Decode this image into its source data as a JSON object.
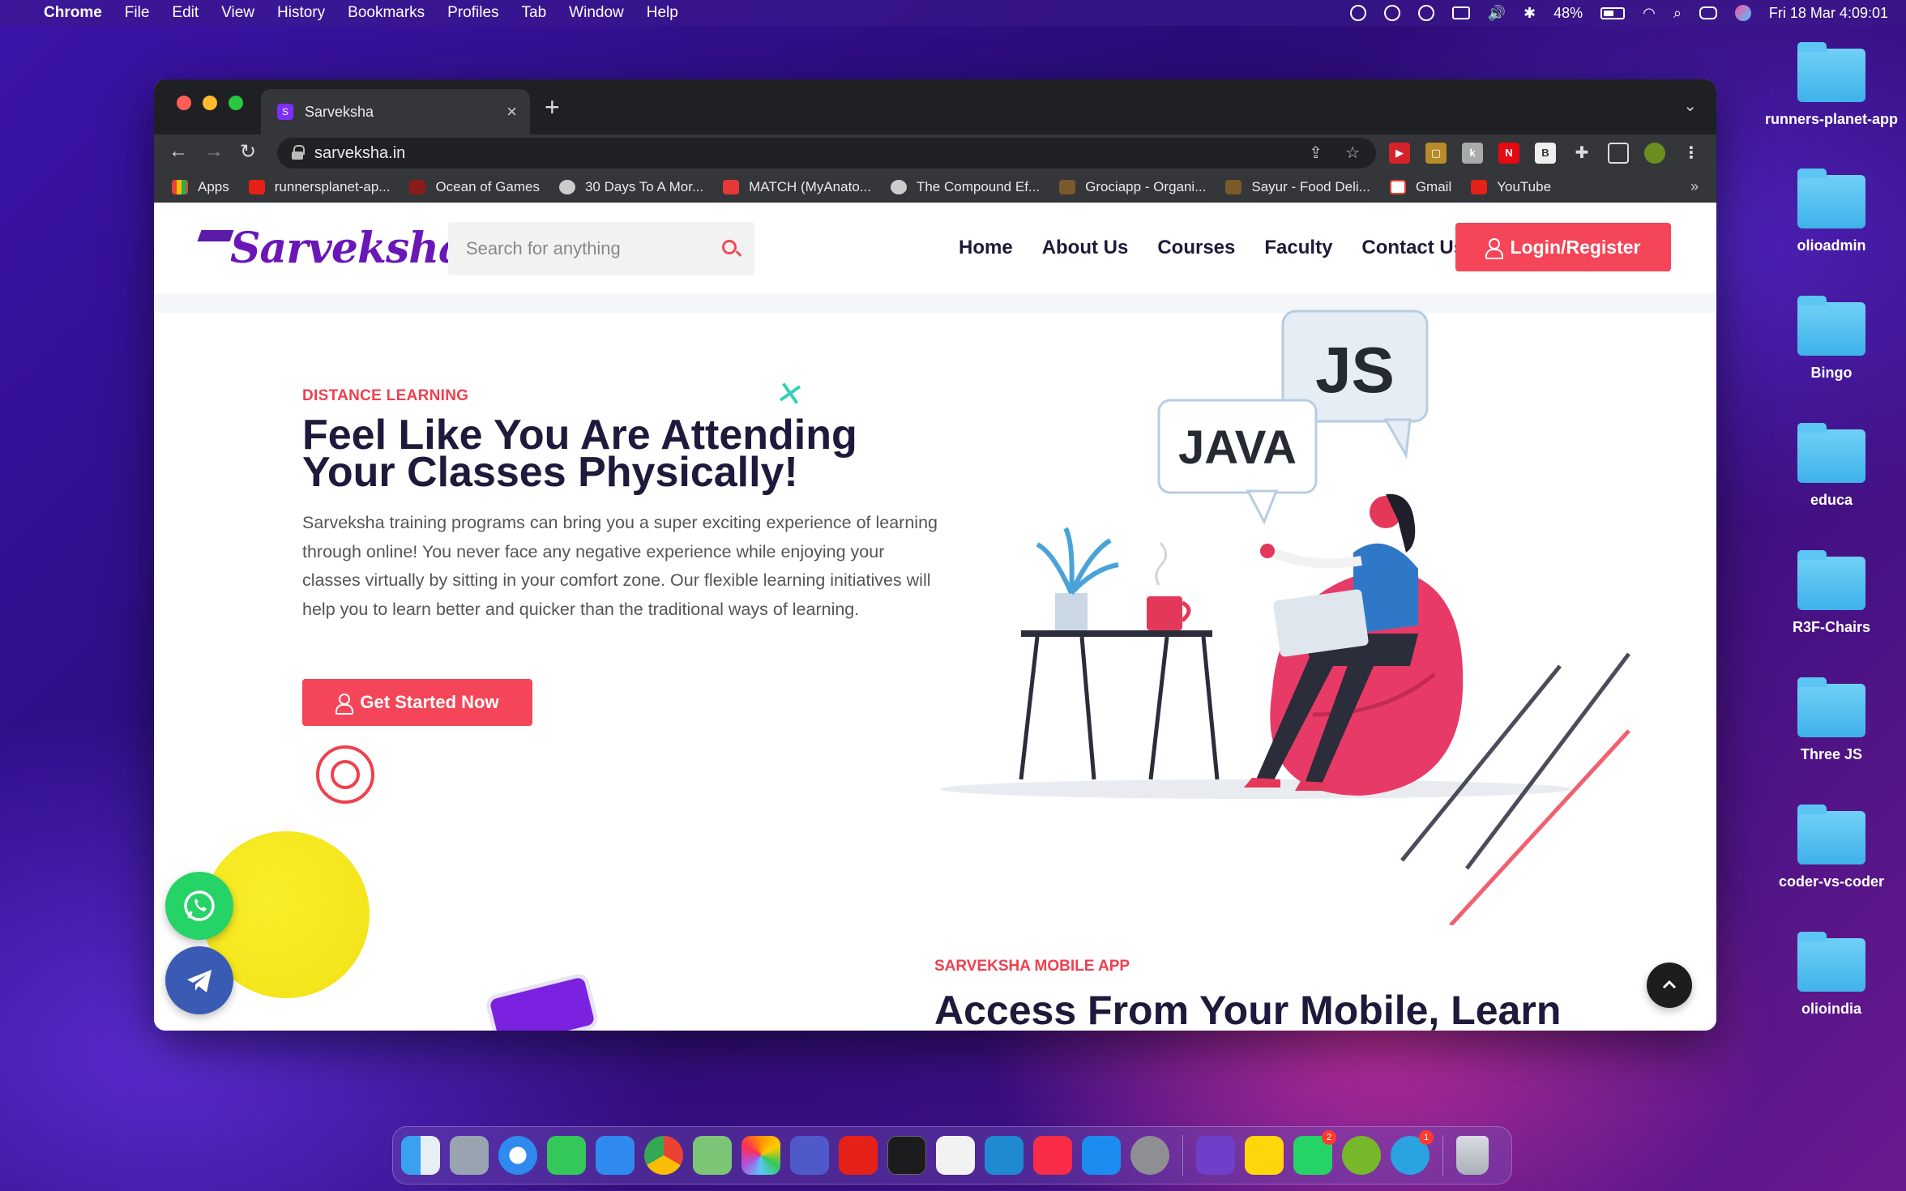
{
  "menubar": {
    "app_name": "Chrome",
    "menus": [
      "File",
      "Edit",
      "View",
      "History",
      "Bookmarks",
      "Profiles",
      "Tab",
      "Window",
      "Help"
    ],
    "battery": "48%",
    "datetime": "Fri 18 Mar  4:09:01"
  },
  "desktop_folders": [
    "runners-planet-app",
    "olioadmin",
    "Bingo",
    "educa",
    "R3F-Chairs",
    "Three JS",
    "coder-vs-coder",
    "olioindia"
  ],
  "browser": {
    "tab_title": "Sarveksha",
    "url": "sarveksha.in",
    "bookmarks": [
      "Apps",
      "runnersplanet-ap...",
      "Ocean of Games",
      "30 Days To A Mor...",
      "MATCH (MyAnato...",
      "The Compound Ef...",
      "Grociapp - Organi...",
      "Sayur - Food Deli...",
      "Gmail",
      "YouTube"
    ],
    "bookmarks_more": "»"
  },
  "site": {
    "logo": "Sarveksha",
    "search_placeholder": "Search for anything",
    "nav": [
      "Home",
      "About Us",
      "Courses",
      "Faculty",
      "Contact Us"
    ],
    "login_label": "Login/Register",
    "hero": {
      "eyebrow": "DISTANCE LEARNING",
      "title": "Feel Like You Are Attending Your Classes Physically!",
      "body": "Sarveksha training programs can bring you a super exciting experience of learning through online! You never face any negative experience while enjoying your classes virtually by sitting in your comfort zone. Our flexible learning initiatives will help you to learn better and quicker than the traditional ways of learning.",
      "cta_label": "Get Started Now"
    },
    "illustration": {
      "bubble_1": "JS",
      "bubble_2": "JAVA"
    },
    "app_section": {
      "eyebrow": "SARVEKSHA MOBILE APP",
      "title": "Access From Your Mobile, Learn"
    }
  },
  "dock": {
    "apps": [
      "Finder",
      "Launchpad",
      "Safari",
      "Messages",
      "Mail",
      "Chrome",
      "Maps",
      "Photos",
      "Teams",
      "YouTube",
      "Terminal",
      "Reminders",
      "VS Code",
      "Music",
      "App Store",
      "System Preferences",
      "GitHub Desktop",
      "Notes",
      "WhatsApp",
      "uTorrent",
      "Telegram",
      "Trash"
    ],
    "badges": {
      "whatsapp": "2",
      "telegram": "1"
    }
  },
  "colors": {
    "accent": "#f44658",
    "brand": "#6a17b8",
    "heading": "#1e1a3c"
  }
}
